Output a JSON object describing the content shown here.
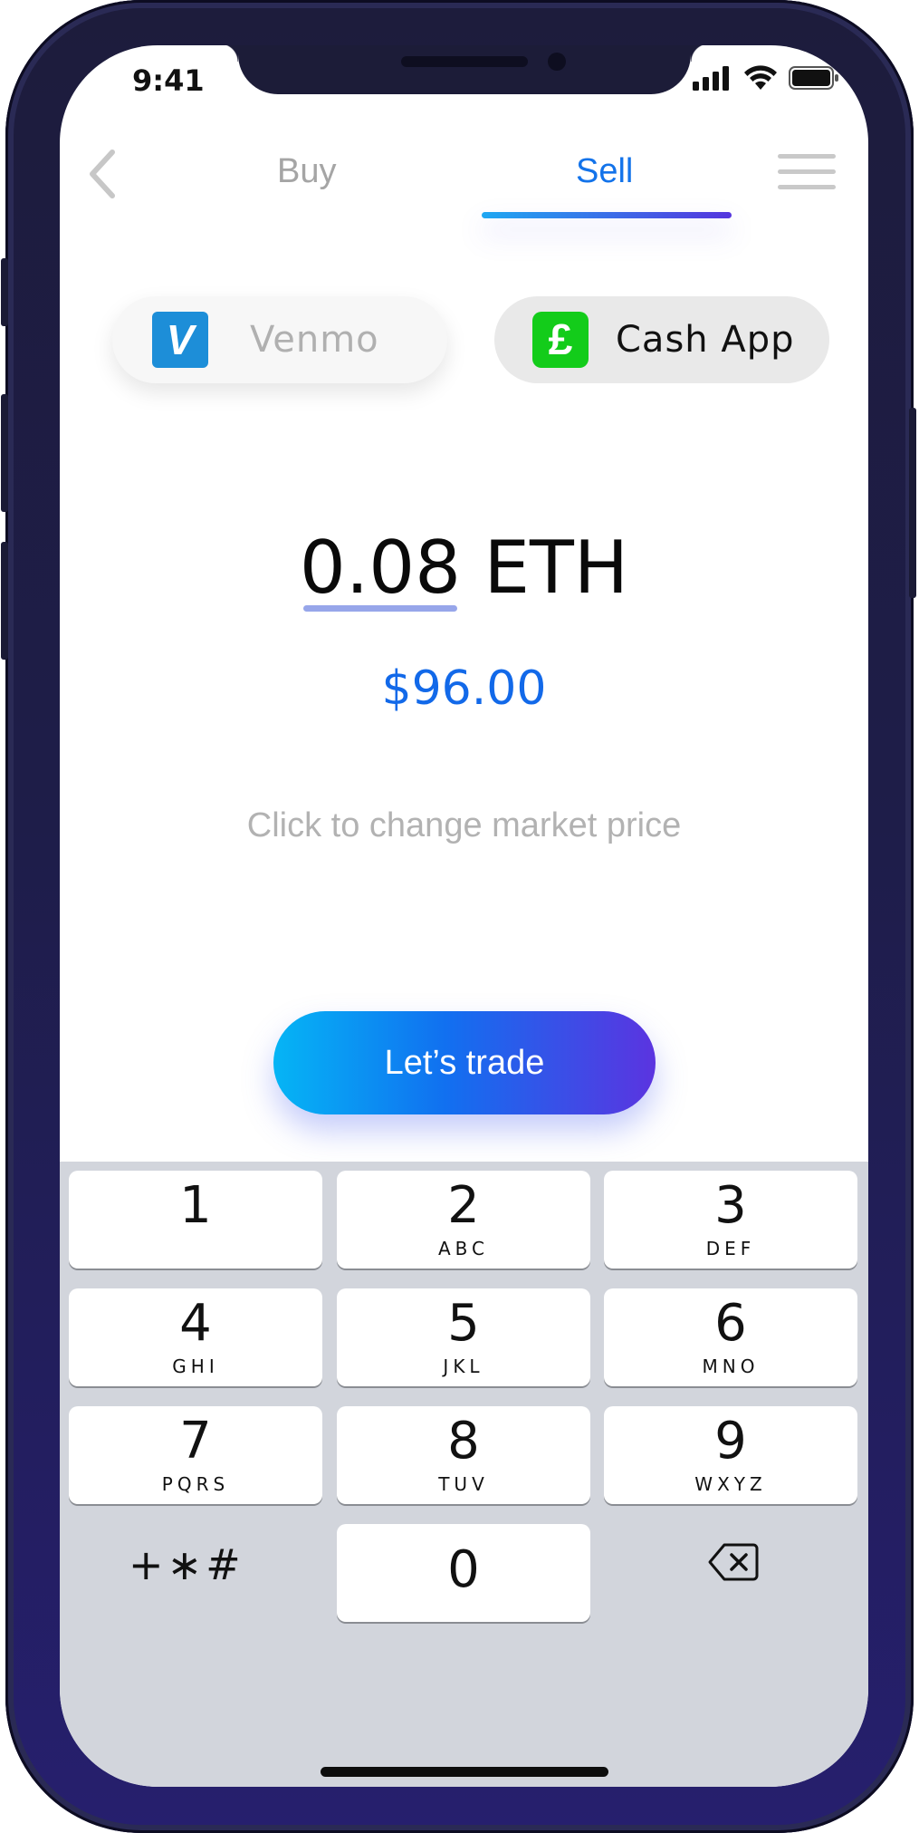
{
  "status_bar": {
    "time": "9:41"
  },
  "nav": {
    "tabs": [
      {
        "label": "Buy",
        "active": false
      },
      {
        "label": "Sell",
        "active": true
      }
    ]
  },
  "payment_methods": [
    {
      "label": "Venmo",
      "logo_glyph": "V",
      "logo_color": "#1d8ed8",
      "selected": false
    },
    {
      "label": "Cash App",
      "logo_glyph": "£",
      "logo_color": "#13cc1a",
      "selected": true
    }
  ],
  "amount": {
    "value": "0.08",
    "unit": "ETH"
  },
  "fiat_value": "$96.00",
  "market_hint": "Click to change market price",
  "trade_button": "Let’s trade",
  "keypad": {
    "keys": [
      {
        "digit": "1",
        "letters": ""
      },
      {
        "digit": "2",
        "letters": "ABC"
      },
      {
        "digit": "3",
        "letters": "DEF"
      },
      {
        "digit": "4",
        "letters": "GHI"
      },
      {
        "digit": "5",
        "letters": "JKL"
      },
      {
        "digit": "6",
        "letters": "MNO"
      },
      {
        "digit": "7",
        "letters": "PQRS"
      },
      {
        "digit": "8",
        "letters": "TUV"
      },
      {
        "digit": "9",
        "letters": "WXYZ"
      },
      {
        "digit": "0",
        "letters": ""
      }
    ],
    "symbols": "+∗#"
  },
  "colors": {
    "accent_blue": "#1373ea",
    "gradient_start": "#05b5f5",
    "gradient_end": "#5b34e0"
  }
}
